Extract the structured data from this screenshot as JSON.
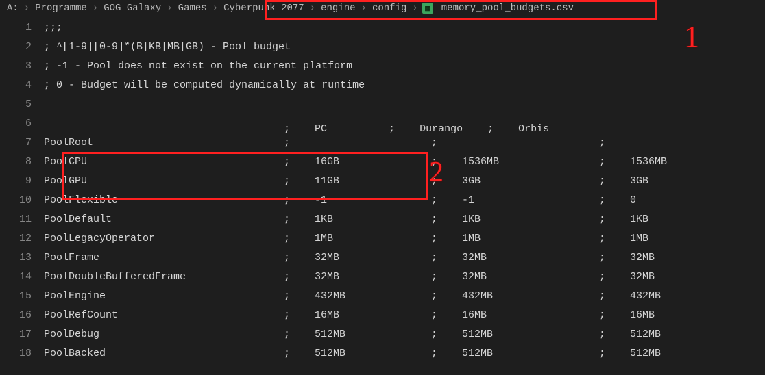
{
  "breadcrumb": {
    "drive": "A:",
    "parts": [
      "Programme",
      "GOG Galaxy",
      "Games",
      "Cyberpunk 2077",
      "engine",
      "config"
    ],
    "file": "memory_pool_budgets.csv"
  },
  "editor": {
    "header_line": {
      "col_pc": "PC",
      "col_durango": "Durango",
      "col_orbis": "Orbis"
    },
    "lines": [
      {
        "n": 1,
        "text": ";;;"
      },
      {
        "n": 2,
        "text": "; ^[1-9][0-9]*(B|KB|MB|GB) - Pool budget"
      },
      {
        "n": 3,
        "text": "; -1 - Pool does not exist on the current platform"
      },
      {
        "n": 4,
        "text": "; 0 - Budget will be computed dynamically at runtime"
      },
      {
        "n": 5,
        "text": ""
      }
    ],
    "rows": [
      {
        "n": 7,
        "name": "PoolRoot",
        "pc": "",
        "durango": "",
        "orbis": ""
      },
      {
        "n": 8,
        "name": "PoolCPU",
        "pc": "16GB",
        "durango": "1536MB",
        "orbis": "1536MB"
      },
      {
        "n": 9,
        "name": "PoolGPU",
        "pc": "11GB",
        "durango": "3GB",
        "orbis": "3GB"
      },
      {
        "n": 10,
        "name": "PoolFlexible",
        "pc": "-1",
        "durango": "-1",
        "orbis": "0"
      },
      {
        "n": 11,
        "name": "PoolDefault",
        "pc": "1KB",
        "durango": "1KB",
        "orbis": "1KB"
      },
      {
        "n": 12,
        "name": "PoolLegacyOperator",
        "pc": "1MB",
        "durango": "1MB",
        "orbis": "1MB"
      },
      {
        "n": 13,
        "name": "PoolFrame",
        "pc": "32MB",
        "durango": "32MB",
        "orbis": "32MB"
      },
      {
        "n": 14,
        "name": "PoolDoubleBufferedFrame",
        "pc": "32MB",
        "durango": "32MB",
        "orbis": "32MB"
      },
      {
        "n": 15,
        "name": "PoolEngine",
        "pc": "432MB",
        "durango": "432MB",
        "orbis": "432MB"
      },
      {
        "n": 16,
        "name": "PoolRefCount",
        "pc": "16MB",
        "durango": "16MB",
        "orbis": "16MB"
      },
      {
        "n": 17,
        "name": "PoolDebug",
        "pc": "512MB",
        "durango": "512MB",
        "orbis": "512MB"
      },
      {
        "n": 18,
        "name": "PoolBacked",
        "pc": "512MB",
        "durango": "512MB",
        "orbis": "512MB"
      }
    ]
  },
  "annotations": {
    "label1": "1",
    "label2": "2"
  }
}
